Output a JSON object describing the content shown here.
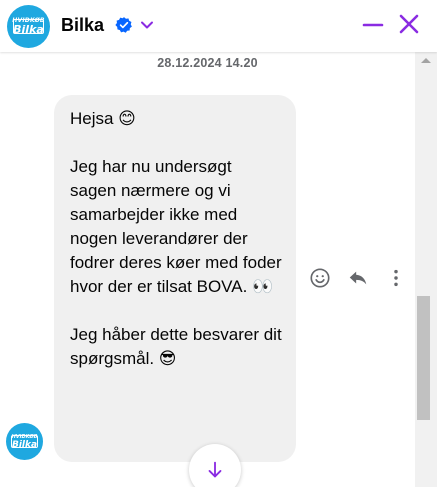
{
  "header": {
    "title": "Bilka",
    "avatar_mini": "HVIDKØB",
    "avatar_big": "Bilka",
    "verified_icon": "verified-badge-icon",
    "chevron_icon": "chevron-down-icon",
    "minimize_icon": "minimize-icon",
    "close_icon": "close-icon",
    "accent_color": "#8a2be2",
    "verified_color": "#0866ff"
  },
  "conversation": {
    "timestamp": "28.12.2024 14.20",
    "message": {
      "text": "Hejsa 😊\n\nJeg har nu undersøgt sagen nærmere og vi samarbejder ikke med nogen leverandører der fodrer deres køer med foder hvor der er tilsat BOVA. 👀\n\nJeg håber dette besvarer dit spørgsmål. 😎",
      "sender_avatar_mini": "HVIDKØB",
      "sender_avatar_big": "Bilka"
    },
    "actions": [
      {
        "name": "react",
        "icon": "smiley-icon"
      },
      {
        "name": "reply",
        "icon": "reply-arrow-icon"
      },
      {
        "name": "more",
        "icon": "more-vertical-icon"
      }
    ],
    "scroll_down_icon": "arrow-down-icon"
  },
  "colors": {
    "bubble_bg": "#f0f0f0",
    "avatar_bg": "#1fa8e0",
    "scroll_arrow": "#8a2be2"
  }
}
